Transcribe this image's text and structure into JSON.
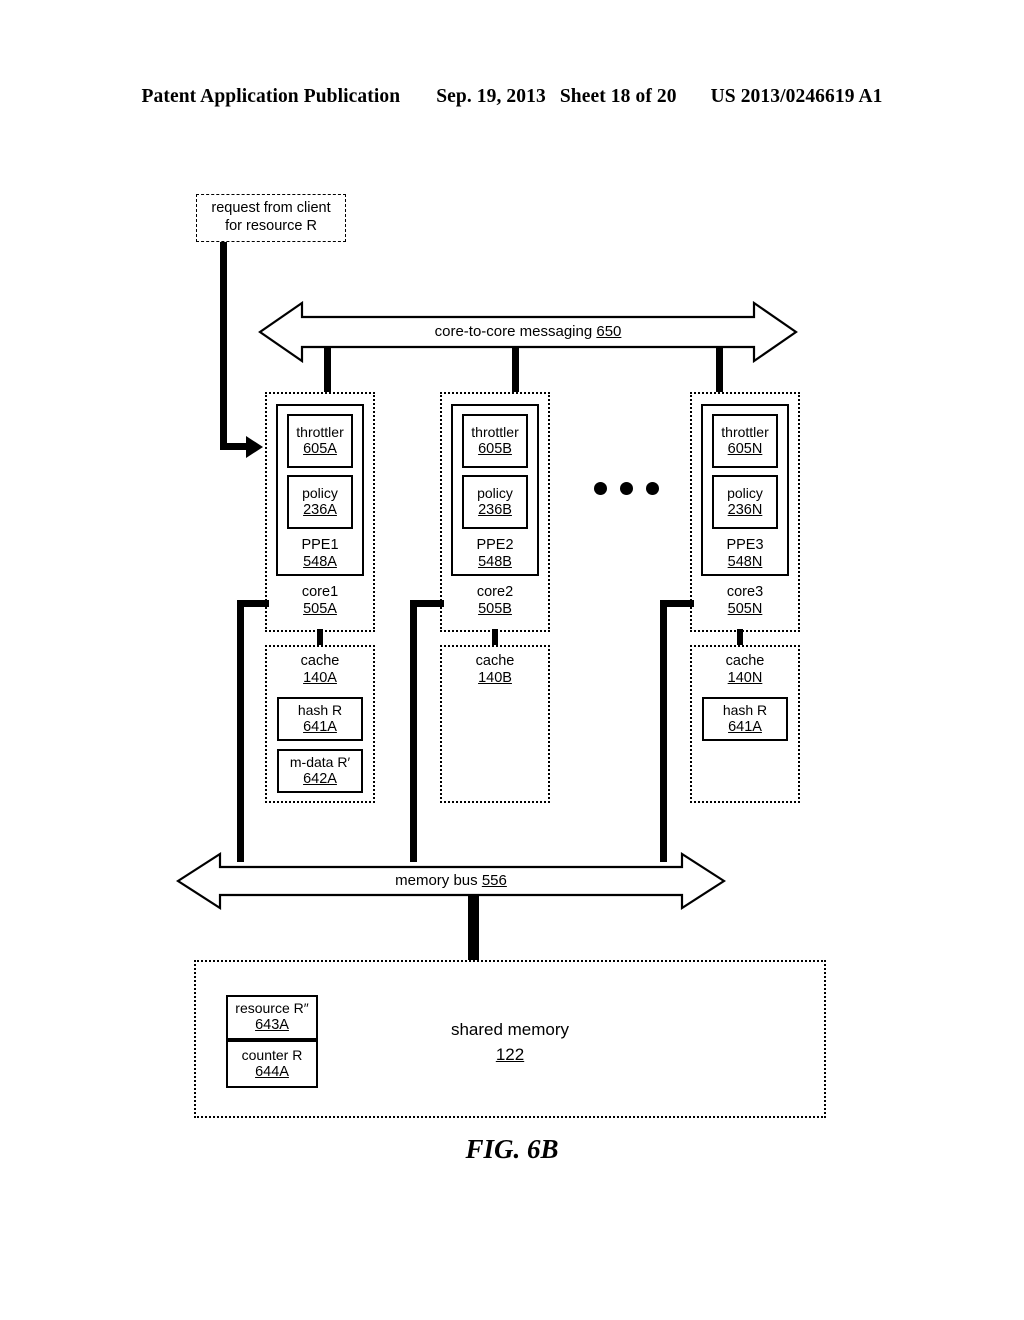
{
  "header": {
    "publication": "Patent Application Publication",
    "date": "Sep. 19, 2013",
    "sheet": "Sheet 18 of 20",
    "patent_number": "US 2013/0246619 A1"
  },
  "figure": {
    "caption": "FIG. 6B"
  },
  "request_box": {
    "line1": "request from client",
    "line2": "for resource R"
  },
  "core_to_core_bus": {
    "label": "core-to-core messaging",
    "ref": "650"
  },
  "memory_bus": {
    "label": "memory bus",
    "ref": "556"
  },
  "ellipsis": "• • •",
  "cores": [
    {
      "core_label": "core1",
      "core_ref": "505A",
      "ppe_label": "PPE1",
      "ppe_ref": "548A",
      "throttler_label": "throttler",
      "throttler_ref": "605A",
      "policy_label": "policy",
      "policy_ref": "236A"
    },
    {
      "core_label": "core2",
      "core_ref": "505B",
      "ppe_label": "PPE2",
      "ppe_ref": "548B",
      "throttler_label": "throttler",
      "throttler_ref": "605B",
      "policy_label": "policy",
      "policy_ref": "236B"
    },
    {
      "core_label": "core3",
      "core_ref": "505N",
      "ppe_label": "PPE3",
      "ppe_ref": "548N",
      "throttler_label": "throttler",
      "throttler_ref": "605N",
      "policy_label": "policy",
      "policy_ref": "236N"
    }
  ],
  "caches": [
    {
      "label": "cache",
      "ref": "140A",
      "entries": [
        {
          "label": "hash R",
          "ref": "641A"
        },
        {
          "label": "m-data R′",
          "ref": "642A"
        }
      ]
    },
    {
      "label": "cache",
      "ref": "140B",
      "entries": []
    },
    {
      "label": "cache",
      "ref": "140N",
      "entries": [
        {
          "label": "hash R",
          "ref": "641A"
        }
      ]
    }
  ],
  "shared_memory": {
    "label": "shared memory",
    "ref": "122",
    "entries": [
      {
        "label": "resource R″",
        "ref": "643A"
      },
      {
        "label": "counter R",
        "ref": "644A"
      }
    ]
  },
  "colors": {
    "ink": "#000000",
    "page": "#ffffff"
  }
}
